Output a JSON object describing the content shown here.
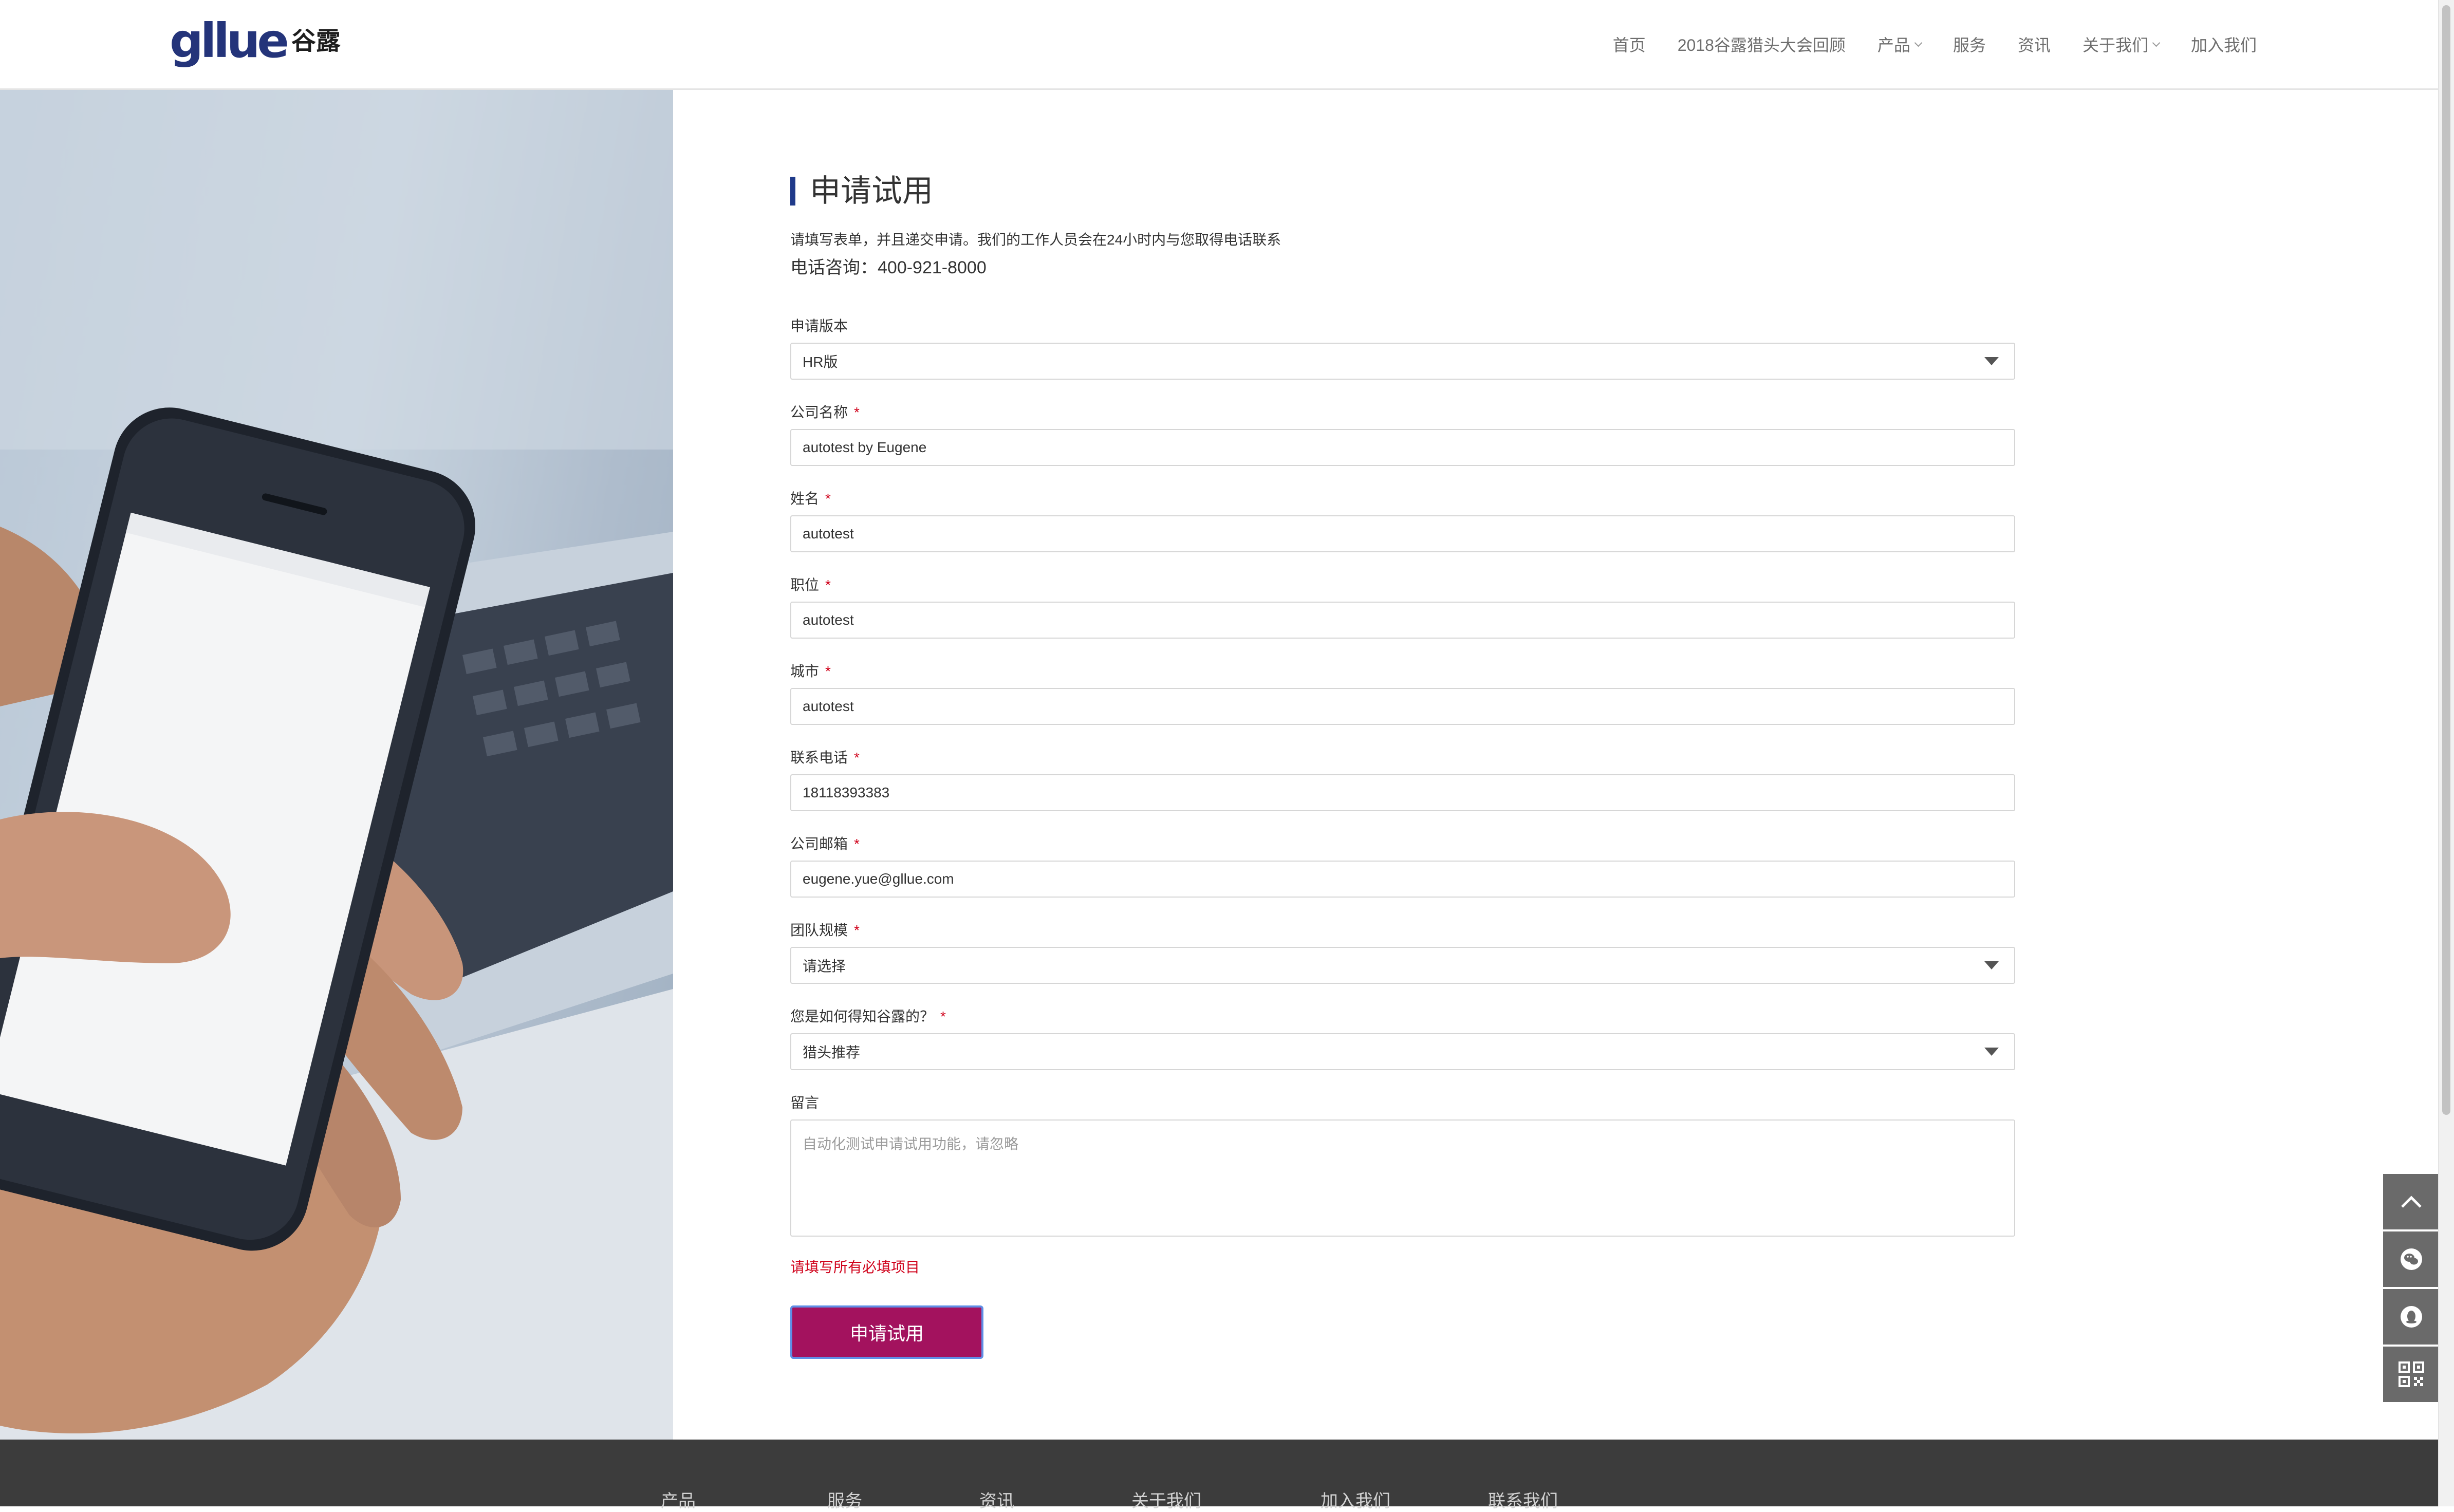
{
  "header": {
    "logo_text": "gllue",
    "logo_cn": "谷露",
    "nav": [
      {
        "label": "首页",
        "dropdown": false
      },
      {
        "label": "2018谷露猎头大会回顾",
        "dropdown": false
      },
      {
        "label": "产品",
        "dropdown": true
      },
      {
        "label": "服务",
        "dropdown": false
      },
      {
        "label": "资讯",
        "dropdown": false
      },
      {
        "label": "关于我们",
        "dropdown": true
      },
      {
        "label": "加入我们",
        "dropdown": false
      }
    ]
  },
  "form": {
    "title": "申请试用",
    "intro": "请填写表单，并且递交申请。我们的工作人员会在24小时内与您取得电话联系",
    "phone": "电话咨询：400-921-8000",
    "fields": {
      "version": {
        "label": "申请版本",
        "value": "HR版"
      },
      "company": {
        "label": "公司名称",
        "value": "autotest by Eugene"
      },
      "name": {
        "label": "姓名",
        "value": "autotest"
      },
      "position": {
        "label": "职位",
        "value": "autotest"
      },
      "city": {
        "label": "城市",
        "value": "autotest"
      },
      "phone": {
        "label": "联系电话",
        "value": "18118393383"
      },
      "email": {
        "label": "公司邮箱",
        "value": "eugene.yue@gllue.com"
      },
      "team_size": {
        "label": "团队规模",
        "value": "请选择"
      },
      "source": {
        "label": "您是如何得知谷露的？",
        "value": "猎头推荐"
      },
      "message": {
        "label": "留言",
        "placeholder": "自动化测试申请试用功能，请忽略"
      }
    },
    "required_mark": "*",
    "error": "请填写所有必填项目",
    "submit_label": "申请试用"
  },
  "footer": {
    "links": [
      "产品",
      "服务",
      "资讯",
      "关于我们",
      "加入我们",
      "联系我们"
    ]
  },
  "colors": {
    "brand": "#24347a",
    "accent_bar": "#1f3a8a",
    "submit": "#a3125e",
    "required": "#d0021b",
    "footer_bg": "#3c3c3c"
  }
}
